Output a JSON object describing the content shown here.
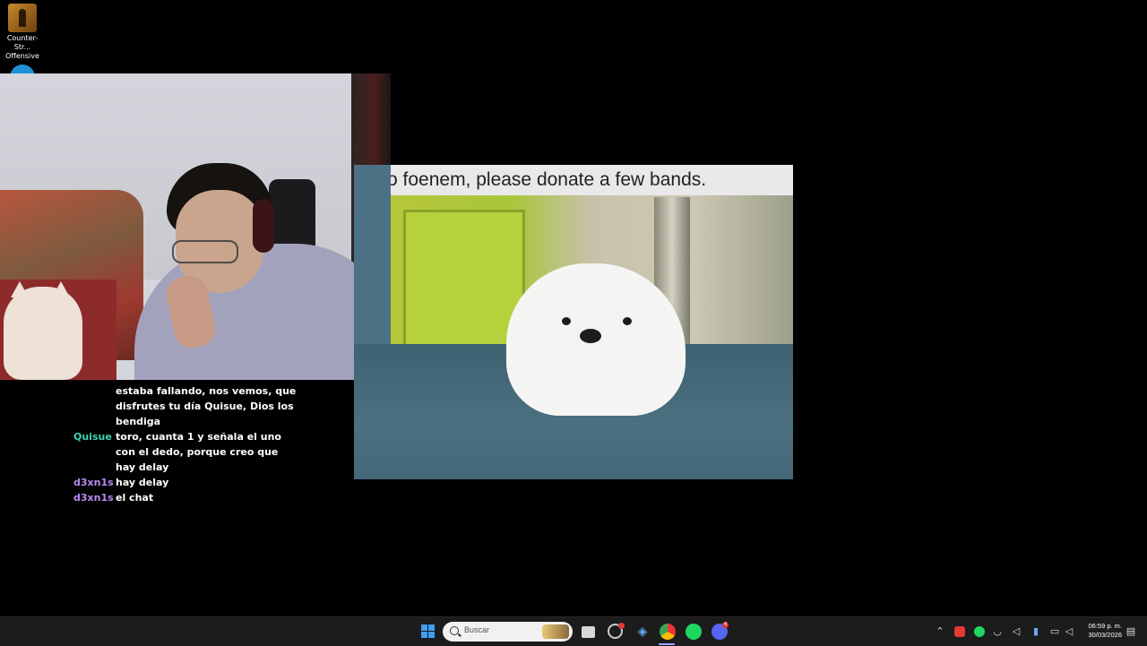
{
  "desktop": {
    "icons": [
      {
        "label": "Counter-Str...\nOffensive",
        "line1": "Counter-Str...",
        "line2": "Offensive"
      }
    ]
  },
  "meme": {
    "caption": "o foenem, please donate a few bands."
  },
  "chat": {
    "continued_lines": [
      "estaba fallando, nos vemos, que",
      "disfrutes tu día Quisue, Dios los",
      "bendiga"
    ],
    "messages": [
      {
        "user": "Quisue",
        "color": "#3fd4b4",
        "lines": [
          "toro, cuanta 1 y señala el uno",
          "con el dedo, porque creo que",
          "hay delay"
        ]
      },
      {
        "user": "d3xn1s",
        "color": "#b88cf2",
        "lines": [
          "hay delay"
        ]
      },
      {
        "user": "d3xn1s",
        "color": "#b88cf2",
        "lines": [
          "el chat"
        ]
      }
    ]
  },
  "taskbar": {
    "search_placeholder": "Buscar",
    "apps": [
      "windows-start",
      "file-explorer",
      "screen-recorder",
      "git-app",
      "chrome",
      "spotify",
      "discord"
    ],
    "discord_badge": "4",
    "clock_time": "06:59 p. m.",
    "clock_date": "30/03/2026",
    "tray_icons": [
      "chevron-up",
      "app-red",
      "spotify",
      "headphones",
      "volume",
      "microphone",
      "network",
      "speaker",
      "notifications"
    ]
  },
  "colors": {
    "quisue": "#3fd4b4",
    "d3xn1s": "#b88cf2",
    "taskbar": "#1c1c1c"
  }
}
